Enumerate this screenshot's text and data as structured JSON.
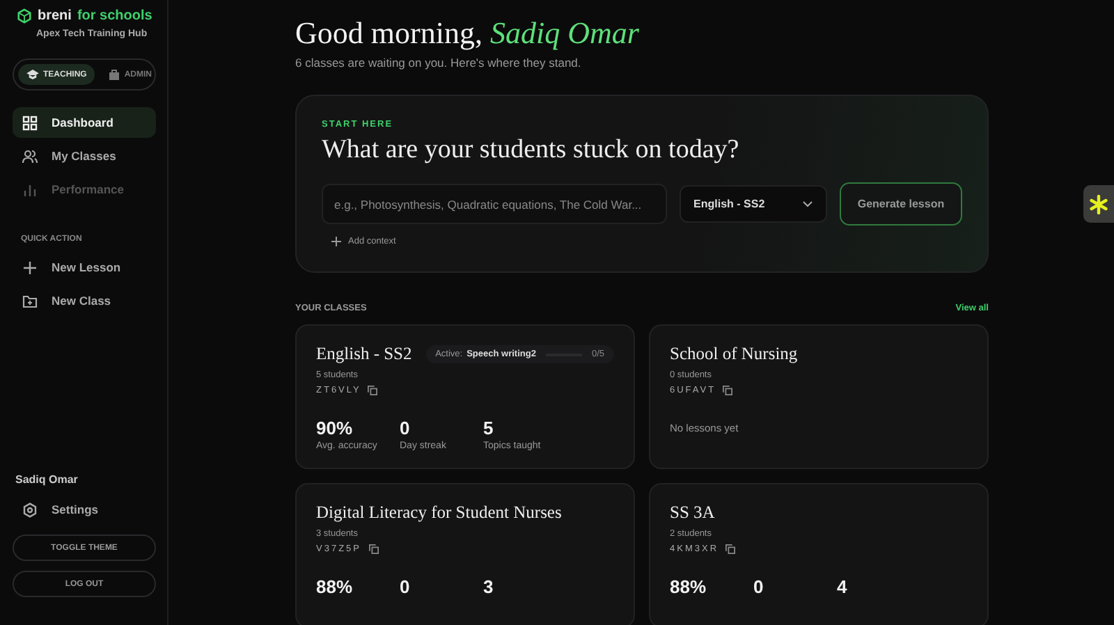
{
  "brand": {
    "name": "breni",
    "suffix": "for schools",
    "org": "Apex Tech Training Hub"
  },
  "modes": [
    {
      "label": "TEACHING",
      "selected": true
    },
    {
      "label": "ADMIN",
      "selected": false
    }
  ],
  "nav": [
    {
      "label": "Dashboard",
      "kind": "grid",
      "selected": true,
      "disabled": false
    },
    {
      "label": "My Classes",
      "kind": "people",
      "selected": false,
      "disabled": false
    },
    {
      "label": "Performance",
      "kind": "chart",
      "selected": false,
      "disabled": true
    }
  ],
  "quick_action": {
    "heading": "QUICK ACTION",
    "items": [
      {
        "label": "New Lesson",
        "kind": "plus"
      },
      {
        "label": "New Class",
        "kind": "folder"
      }
    ]
  },
  "user": {
    "name": "Sadiq Omar",
    "settings": "Settings",
    "buttons": [
      "TOGGLE THEME",
      "LOG OUT"
    ]
  },
  "greeting": {
    "text": "Good morning,",
    "name": "Sadiq Omar",
    "subtitle": "6 classes are waiting on you. Here's where they stand."
  },
  "start": {
    "eyebrow": "START HERE",
    "title": "What are your students stuck on today?",
    "placeholder": "e.g., Photosynthesis, Quadratic equations, The Cold War...",
    "class_select": "English - SS2",
    "button": "Generate lesson",
    "add_context": "Add context"
  },
  "classes": {
    "heading": "YOUR CLASSES",
    "view_all": "View all",
    "items": [
      {
        "name": "English - SS2",
        "students": "5 students",
        "code": "ZT6VLY",
        "active": {
          "label": "Active:",
          "lesson": "Speech writing2",
          "progress": "0/5",
          "level": 0
        },
        "stats": [
          {
            "value": "90%",
            "label": "Avg. accuracy"
          },
          {
            "value": "0",
            "label": "Day streak"
          },
          {
            "value": "5",
            "label": "Topics taught"
          }
        ]
      },
      {
        "name": "School of Nursing",
        "students": "0 students",
        "code": "6UFAVT",
        "empty": "No lessons yet"
      },
      {
        "name": "Digital Literacy for Student Nurses",
        "students": "3 students",
        "code": "V37Z5P",
        "stats": [
          {
            "value": "88%"
          },
          {
            "value": "0"
          },
          {
            "value": "3"
          }
        ]
      },
      {
        "name": "SS 3A",
        "students": "2 students",
        "code": "4KM3XR",
        "stats": [
          {
            "value": "88%"
          },
          {
            "value": "0"
          },
          {
            "value": "4"
          }
        ]
      }
    ]
  }
}
